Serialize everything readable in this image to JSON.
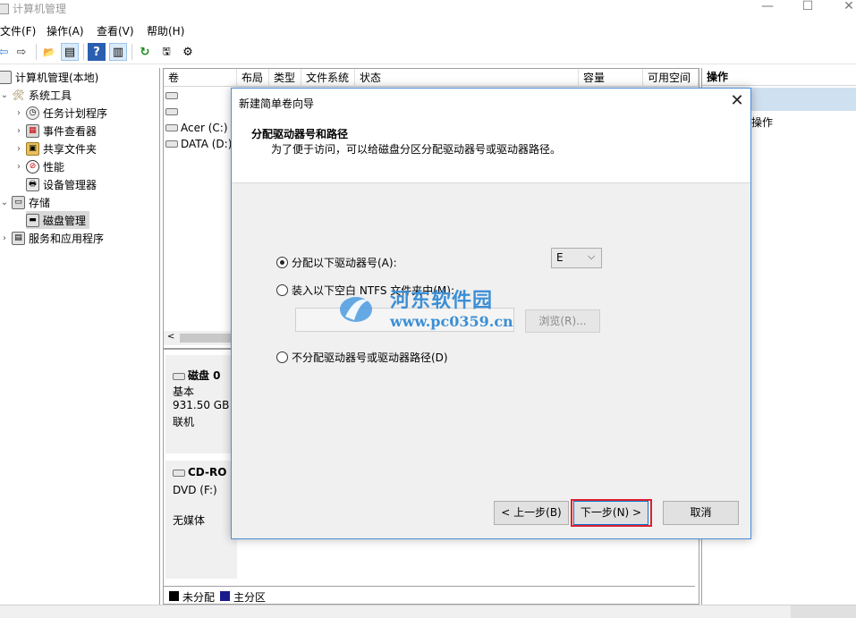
{
  "window": {
    "title": "计算机管理",
    "min": "—",
    "max": "☐",
    "close": "✕"
  },
  "menu": [
    {
      "label": "文件(F)"
    },
    {
      "label": "操作(A)"
    },
    {
      "label": "查看(V)"
    },
    {
      "label": "帮助(H)"
    }
  ],
  "toolbar": {
    "back": "⇦",
    "forward": "⇨",
    "up": "📂",
    "show_tree": "▤",
    "help": "?",
    "show_pane": "▥",
    "refresh": "↻",
    "properties": "🖫",
    "export": "⚙"
  },
  "tree": {
    "root": "计算机管理(本地)",
    "system_tools": "系统工具",
    "task_scheduler": "任务计划程序",
    "event_viewer": "事件查看器",
    "shared_folders": "共享文件夹",
    "performance": "性能",
    "device_manager": "设备管理器",
    "storage": "存储",
    "disk_management": "磁盘管理",
    "services": "服务和应用程序"
  },
  "columns": {
    "volume": "卷",
    "layout": "布局",
    "type": "类型",
    "filesystem": "文件系统",
    "status": "状态",
    "capacity": "容量",
    "free_space": "可用空间"
  },
  "volumes": [
    {
      "name": ""
    },
    {
      "name": ""
    },
    {
      "name": "Acer (C:)"
    },
    {
      "name": "DATA (D:)"
    }
  ],
  "disks": {
    "disk0": {
      "title": "磁盘 0",
      "kind": "基本",
      "size": "931.50 GB",
      "state": "联机"
    },
    "cdrom": {
      "title": "CD-RO",
      "drive": "DVD (F:)",
      "media": "无媒体"
    }
  },
  "legend": {
    "unallocated": "未分配",
    "primary": "主分区",
    "unallocated_color": "#000000",
    "primary_color": "#1a1a8c"
  },
  "actions": {
    "header": "操作",
    "more": "操作"
  },
  "dialog": {
    "title": "新建简单卷向导",
    "close": "✕",
    "heading": "分配驱动器号和路径",
    "subheading": "为了便于访问，可以给磁盘分区分配驱动器号或驱动器路径。",
    "option_assign": "分配以下驱动器号(A):",
    "option_mount": "装入以下空白 NTFS 文件夹中(M):",
    "option_none": "不分配驱动器号或驱动器路径(D)",
    "drive_letter": "E",
    "browse": "浏览(R)...",
    "path_value": "",
    "back": "< 上一步(B)",
    "next": "下一步(N) >",
    "cancel": "取消"
  },
  "watermark": {
    "name": "河东软件园",
    "url": "www.pc0359.cn"
  }
}
